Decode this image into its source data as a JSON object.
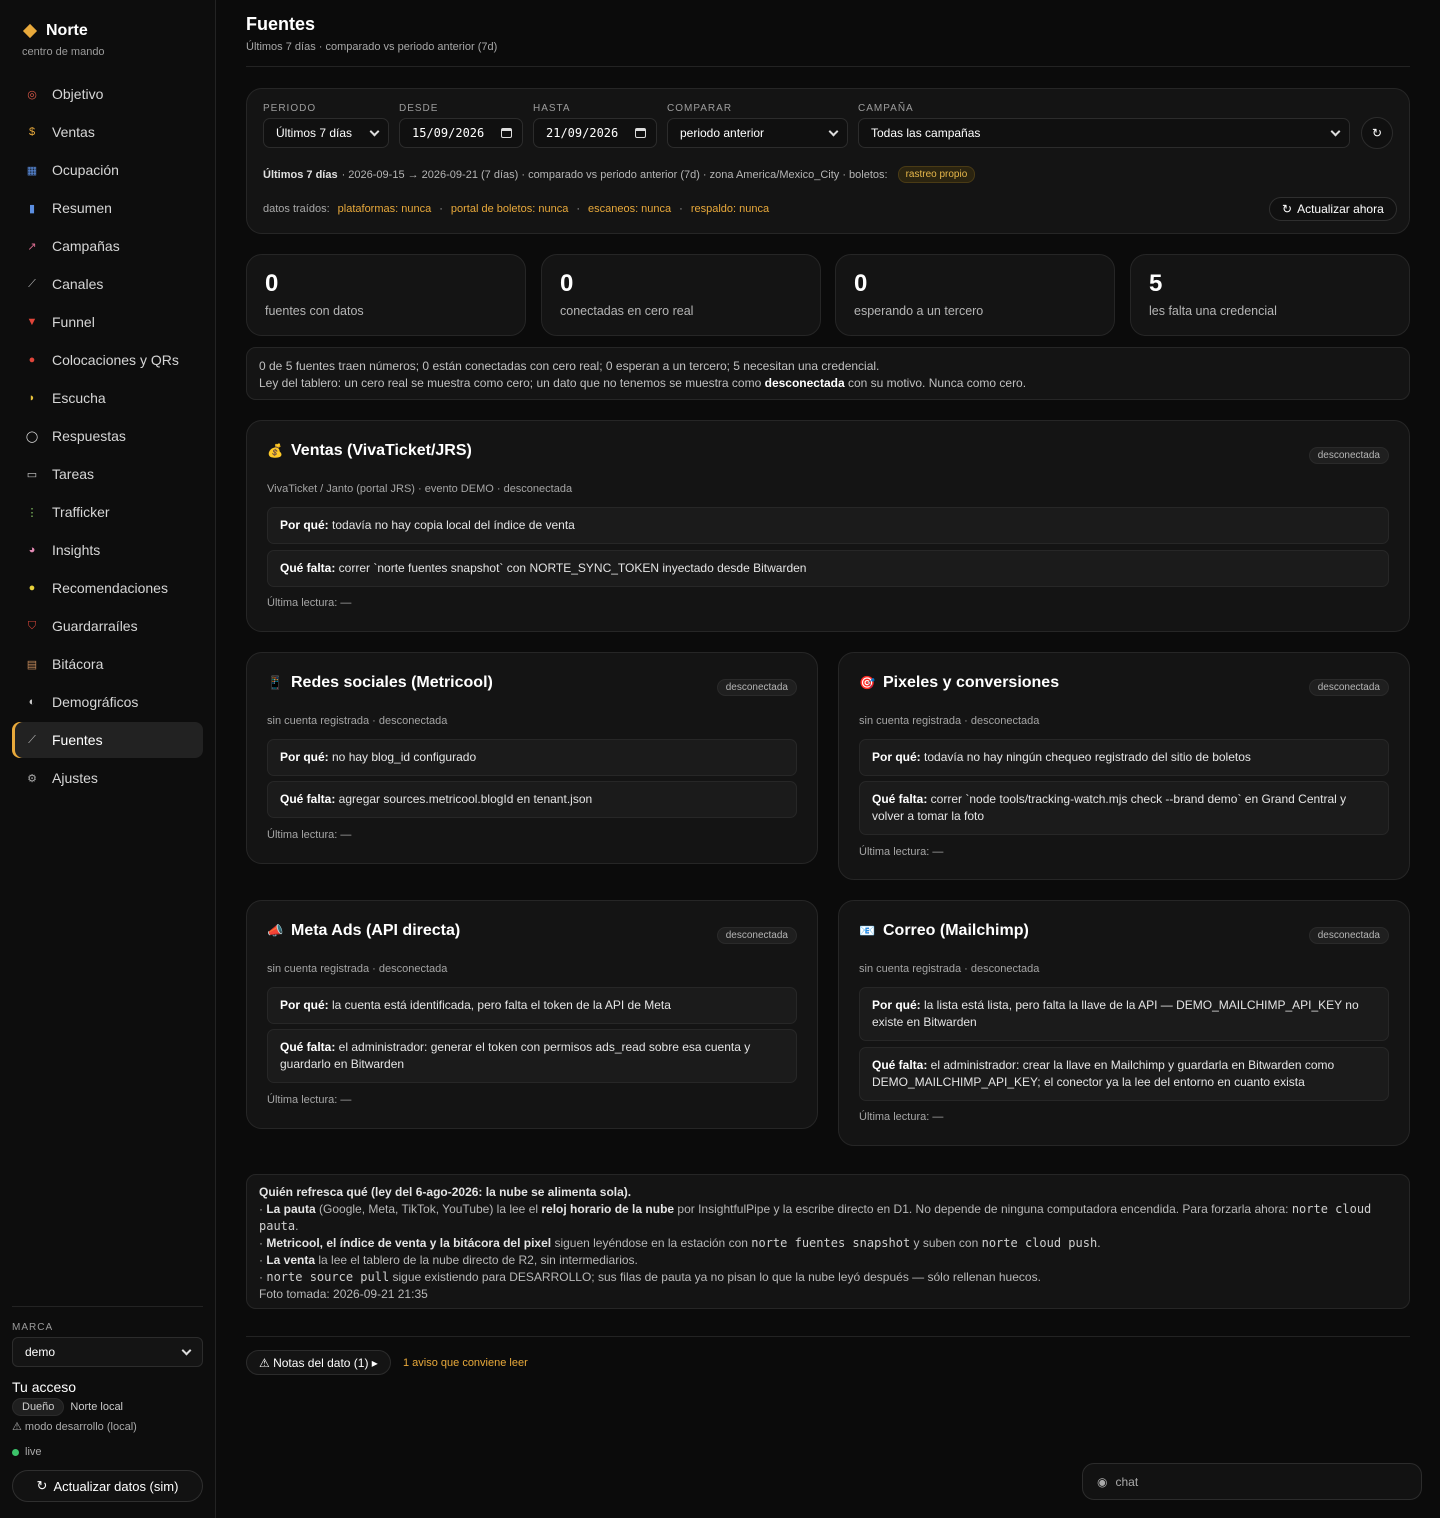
{
  "brand": {
    "name": "Norte",
    "subtitle": "centro de mando"
  },
  "nav": [
    {
      "label": "Objetivo",
      "icon": "target-icon",
      "glyph": "◎"
    },
    {
      "label": "Ventas",
      "icon": "money-bag-icon",
      "glyph": "$"
    },
    {
      "label": "Ocupación",
      "icon": "seats-icon",
      "glyph": "▦"
    },
    {
      "label": "Resumen",
      "icon": "bar-chart-icon",
      "glyph": "▮"
    },
    {
      "label": "Campañas",
      "icon": "trend-chart-icon",
      "glyph": "↗"
    },
    {
      "label": "Canales",
      "icon": "satellite-icon",
      "glyph": "⟋"
    },
    {
      "label": "Funnel",
      "icon": "funnel-icon",
      "glyph": "▼"
    },
    {
      "label": "Colocaciones y QRs",
      "icon": "pin-icon",
      "glyph": "●"
    },
    {
      "label": "Escucha",
      "icon": "ear-icon",
      "glyph": "◗"
    },
    {
      "label": "Respuestas",
      "icon": "speech-bubble-icon",
      "glyph": "◯"
    },
    {
      "label": "Tareas",
      "icon": "clipboard-icon",
      "glyph": "▭"
    },
    {
      "label": "Trafficker",
      "icon": "traffic-light-icon",
      "glyph": "⋮"
    },
    {
      "label": "Insights",
      "icon": "brain-icon",
      "glyph": "◕"
    },
    {
      "label": "Recomendaciones",
      "icon": "lightbulb-icon",
      "glyph": "●"
    },
    {
      "label": "Guardarraíles",
      "icon": "shield-icon",
      "glyph": "⛉"
    },
    {
      "label": "Bitácora",
      "icon": "scroll-icon",
      "glyph": "▤"
    },
    {
      "label": "Demográficos",
      "icon": "compass-icon",
      "glyph": "◐"
    },
    {
      "label": "Fuentes",
      "icon": "satellite-dish-icon",
      "glyph": "⟋"
    },
    {
      "label": "Ajustes",
      "icon": "gear-icon",
      "glyph": "⚙"
    }
  ],
  "sidebar_footer": {
    "marca_label": "MARCA",
    "marca_value": "demo",
    "access_title": "Tu acceso",
    "role": "Dueño",
    "location": "Norte local",
    "mode": "⚠ modo desarrollo (local)",
    "live": "live",
    "sim_button": "Actualizar datos (sim)"
  },
  "header": {
    "title": "Fuentes",
    "subtitle": "Últimos 7 días · comparado vs periodo anterior (7d)"
  },
  "filters": {
    "periodo_label": "PERIODO",
    "periodo_value": "Últimos 7 días",
    "desde_label": "DESDE",
    "desde_value": "15/09/2026",
    "hasta_label": "HASTA",
    "hasta_value": "21/09/2026",
    "comparar_label": "COMPARAR",
    "comparar_value": "periodo anterior",
    "campana_label": "CAMPAÑA",
    "campana_value": "Todas las campañas",
    "refresh_glyph": "↻",
    "summary_bold": "Últimos 7 días",
    "summary_text": "· 2026-09-15 → 2026-09-21 (7 días) · comparado vs periodo anterior (7d) · zona America/Mexico_City · boletos:",
    "summary_badge": "rastreo propio",
    "datos_label": "datos traídos:",
    "datos": [
      "plataformas: nunca",
      "portal de boletos: nunca",
      "escaneos: nunca",
      "respaldo: nunca"
    ],
    "datos_sep": "·",
    "actualizar": "Actualizar ahora"
  },
  "stats": [
    {
      "value": "0",
      "label": "fuentes con datos"
    },
    {
      "value": "0",
      "label": "conectadas en cero real"
    },
    {
      "value": "0",
      "label": "esperando a un tercero"
    },
    {
      "value": "5",
      "label": "les falta una credencial"
    }
  ],
  "note": {
    "line1": "0 de 5 fuentes traen números; 0 están conectadas con cero real; 0 esperan a un tercero; 5 necesitan una credencial.",
    "line2_a": "Ley del tablero: un cero real se muestra como cero; un dato que no tenemos se muestra como ",
    "line2_b": "desconectada",
    "line2_c": " con su motivo. Nunca como cero."
  },
  "labels": {
    "por_que": "Por qué:",
    "que_falta": "Qué falta:",
    "ultima": "Última lectura: —"
  },
  "sources": {
    "ventas": {
      "emoji": "💰",
      "icon": "money-bag-icon",
      "title": "Ventas (VivaTicket/JRS)",
      "badge": "desconectada",
      "meta": "VivaTicket / Janto (portal JRS) · evento DEMO · desconectada",
      "por_que": " todavía no hay copia local del índice de venta",
      "que_falta": " correr `norte fuentes snapshot` con NORTE_SYNC_TOKEN inyectado desde Bitwarden"
    },
    "redes": {
      "emoji": "📱",
      "icon": "phone-icon",
      "title": "Redes sociales (Metricool)",
      "badge": "desconectada",
      "meta": "sin cuenta registrada · desconectada",
      "por_que": " no hay blog_id configurado",
      "que_falta": " agregar sources.metricool.blogId en tenant.json"
    },
    "pixeles": {
      "emoji": "🎯",
      "icon": "target-icon",
      "title": "Pixeles y conversiones",
      "badge": "desconectada",
      "meta": "sin cuenta registrada · desconectada",
      "por_que": " todavía no hay ningún chequeo registrado del sitio de boletos",
      "que_falta": " correr `node tools/tracking-watch.mjs check --brand demo` en Grand Central y volver a tomar la foto"
    },
    "meta": {
      "emoji": "📣",
      "icon": "megaphone-icon",
      "title": "Meta Ads (API directa)",
      "badge": "desconectada",
      "meta": "sin cuenta registrada · desconectada",
      "por_que": " la cuenta está identificada, pero falta el token de la API de Meta",
      "que_falta": " el administrador: generar el token con permisos ads_read sobre esa cuenta y guardarlo en Bitwarden"
    },
    "correo": {
      "emoji": "📧",
      "icon": "mail-icon",
      "title": "Correo (Mailchimp)",
      "badge": "desconectada",
      "meta": "sin cuenta registrada · desconectada",
      "por_que": " la lista está lista, pero falta la llave de la API — DEMO_MAILCHIMP_API_KEY no existe en Bitwarden",
      "que_falta": " el administrador: crear la llave en Mailchimp y guardarla en Bitwarden como DEMO_MAILCHIMP_API_KEY; el conector ya la lee del entorno en cuanto exista"
    }
  },
  "info": {
    "title": "Quién refresca qué (ley del 6-ago-2026: la nube se alimenta sola).",
    "l1_a": "· ",
    "l1_b": "La pauta",
    "l1_c": " (Google, Meta, TikTok, YouTube) la lee el ",
    "l1_d": "reloj horario de la nube",
    "l1_e": " por InsightfulPipe y la escribe directo en D1. No depende de ninguna computadora encendida. Para forzarla ahora: ",
    "l1_f": "norte cloud pauta",
    "l1_g": ".",
    "l2_a": "· ",
    "l2_b": "Metricool, el índice de venta y la bitácora del pixel",
    "l2_c": " siguen leyéndose en la estación con ",
    "l2_d": "norte fuentes snapshot",
    "l2_e": " y suben con ",
    "l2_f": "norte cloud push",
    "l2_g": ".",
    "l3_a": "· ",
    "l3_b": "La venta",
    "l3_c": " la lee el tablero de la nube directo de R2, sin intermediarios.",
    "l4_a": "· ",
    "l4_b": "norte source pull",
    "l4_c": " sigue existiendo para DESARROLLO; sus filas de pauta ya no pisan lo que la nube leyó después — sólo rellenan huecos.",
    "l5": "Foto tomada: 2026-09-21 21:35"
  },
  "footer": {
    "notas": "⚠ Notas del dato (1) ▸",
    "aviso": "1 aviso que conviene leer"
  },
  "chat": {
    "placeholder": "chat"
  },
  "colors": {
    "accent": "#e8a93b",
    "background": "#0b0b0b",
    "card": "#141414",
    "live": "#3cc36a"
  }
}
